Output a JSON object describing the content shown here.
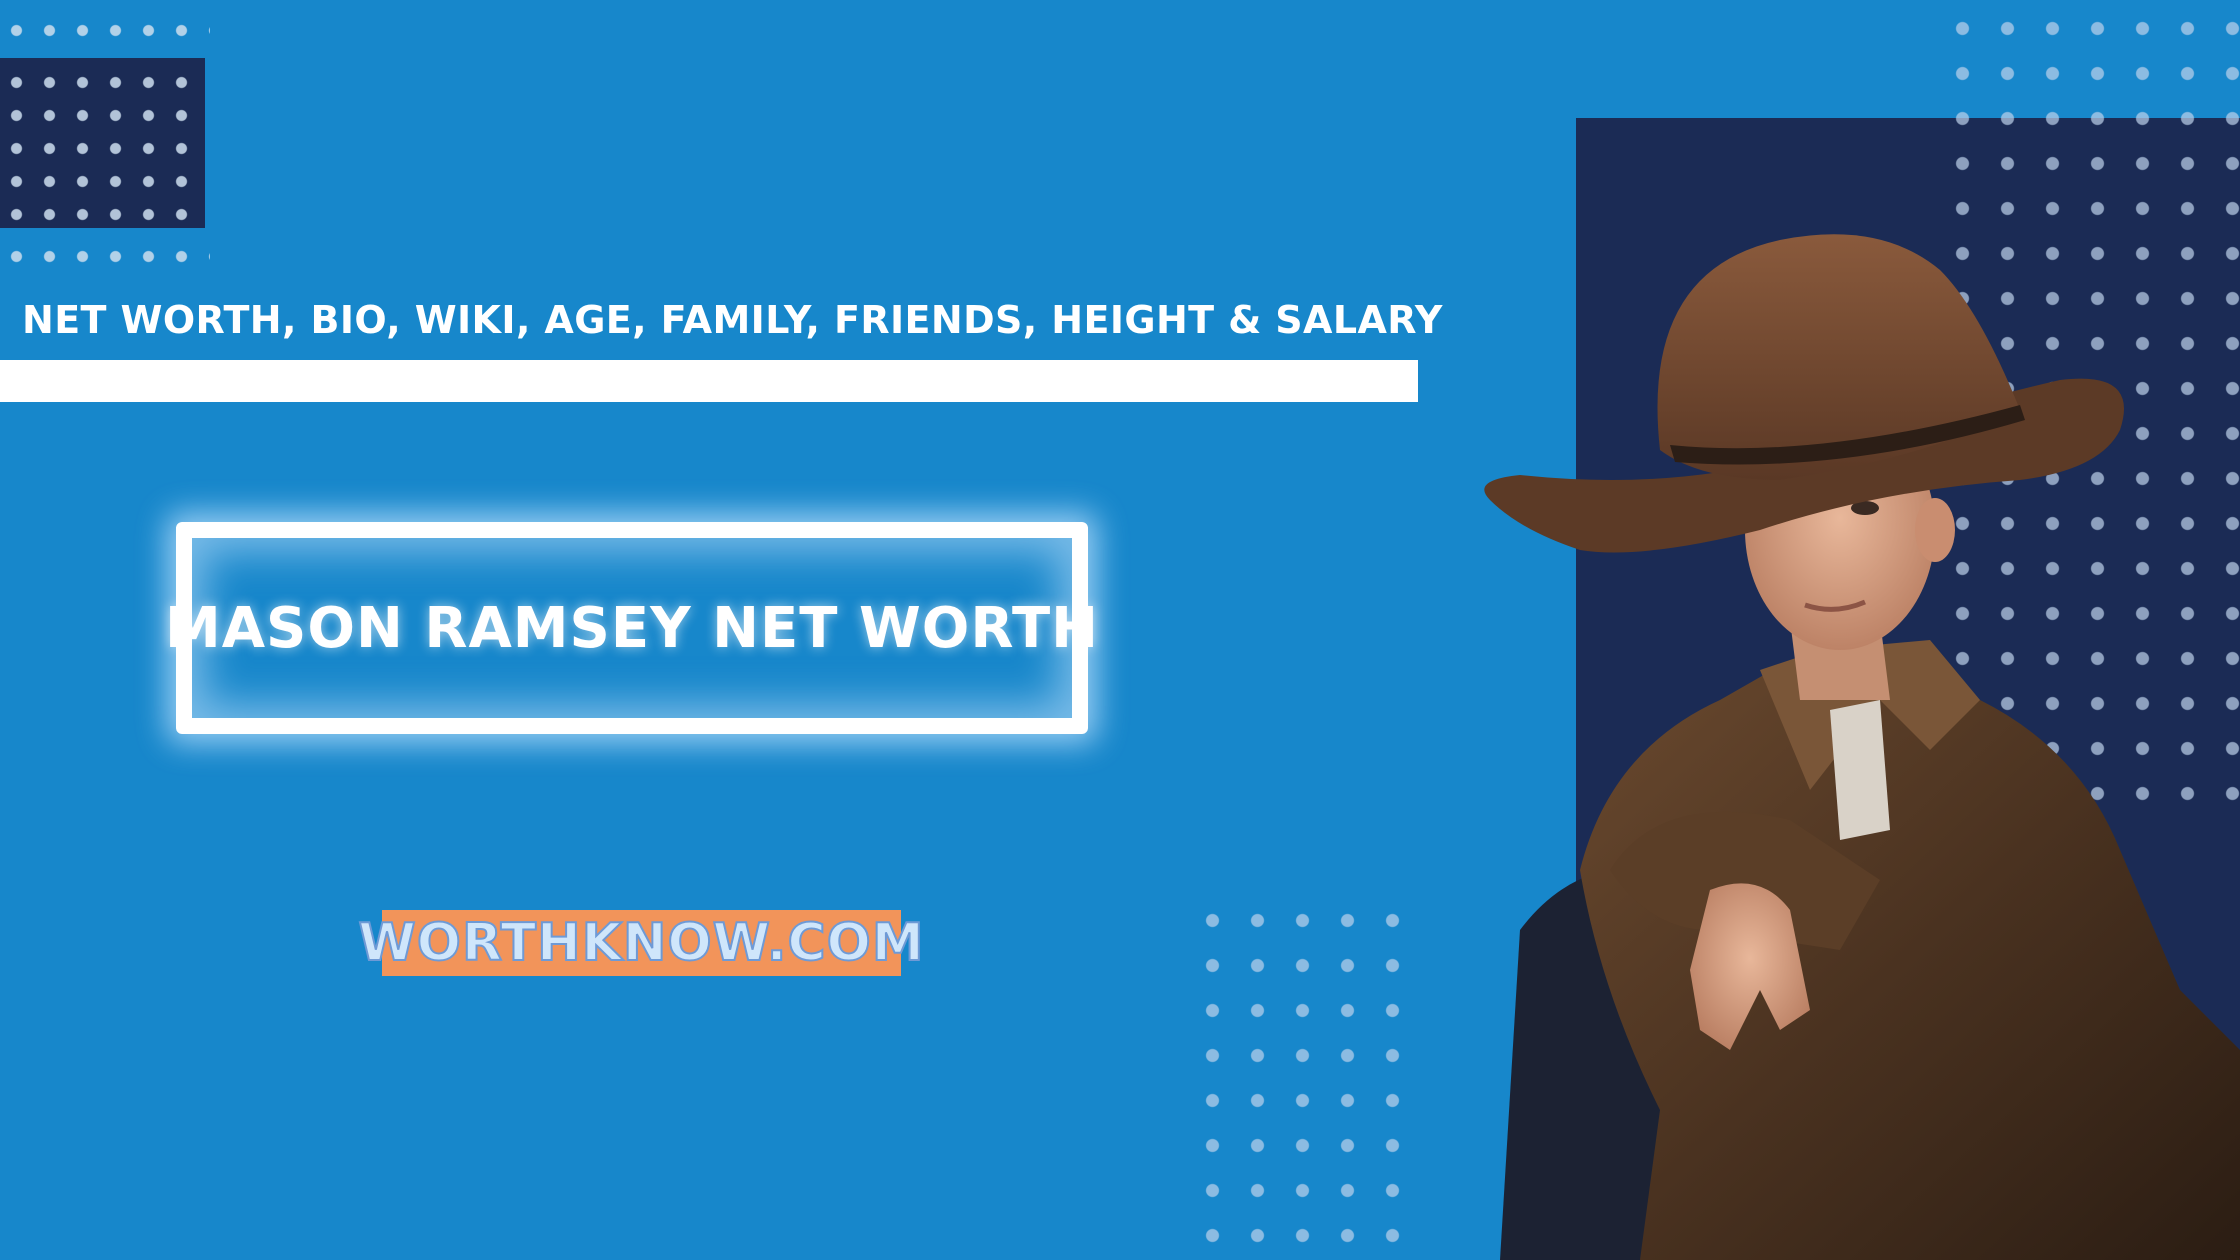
{
  "header": {
    "subtitle": "NET WORTH, BIO, WIKI, AGE, FAMILY, FRIENDS, HEIGHT & SALARY"
  },
  "main": {
    "title": "MASON RAMSEY NET WORTH"
  },
  "badge": {
    "text": "WORTHKNOW.COM"
  },
  "colors": {
    "background": "#1787cb",
    "navy": "#1b2b55",
    "accent_orange": "#f2945a",
    "white": "#ffffff"
  }
}
